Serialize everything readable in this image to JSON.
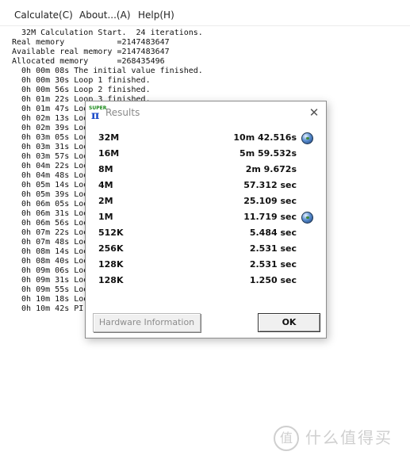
{
  "menu": {
    "calculate": "Calculate(C)",
    "about": "About...(A)",
    "help": "Help(H)"
  },
  "log_lines": [
    "  32M Calculation Start.  24 iterations.",
    "Real memory           =2147483647",
    "Available real memory =2147483647",
    "Allocated memory      =268435496",
    "  0h 00m 08s The initial value finished.",
    "  0h 00m 30s Loop 1 finished.",
    "  0h 00m 56s Loop 2 finished.",
    "  0h 01m 22s Loop 3 finished.",
    "  0h 01m 47s Loo",
    "  0h 02m 13s Loo",
    "  0h 02m 39s Loo",
    "  0h 03m 05s Loo",
    "  0h 03m 31s Loo",
    "  0h 03m 57s Loo",
    "  0h 04m 22s Loo",
    "  0h 04m 48s Loo",
    "  0h 05m 14s Loo",
    "  0h 05m 39s Loo",
    "  0h 06m 05s Loo",
    "  0h 06m 31s Loo",
    "  0h 06m 56s Loo",
    "  0h 07m 22s Loo",
    "  0h 07m 48s Loo",
    "  0h 08m 14s Loo",
    "  0h 08m 40s Loo",
    "  0h 09m 06s Loo",
    "  0h 09m 31s Loo",
    "  0h 09m 55s Loo",
    "  0h 10m 18s Loo",
    "  0h 10m 42s PI"
  ],
  "dialog": {
    "app_icon_text": "SUPER",
    "app_icon_glyph": "π",
    "title": "Results",
    "close_glyph": "✕",
    "results": [
      {
        "size": "32M",
        "time": "10m 42.516s",
        "globe": true
      },
      {
        "size": "16M",
        "time": "5m 59.532s",
        "globe": false
      },
      {
        "size": "8M",
        "time": "2m 9.672s",
        "globe": false
      },
      {
        "size": "4M",
        "time": "57.312 sec",
        "globe": false
      },
      {
        "size": "2M",
        "time": "25.109 sec",
        "globe": false
      },
      {
        "size": "1M",
        "time": "11.719 sec",
        "globe": true
      },
      {
        "size": "512K",
        "time": "5.484 sec",
        "globe": false
      },
      {
        "size": "256K",
        "time": "2.531 sec",
        "globe": false
      },
      {
        "size": "128K",
        "time": "2.531 sec",
        "globe": false
      },
      {
        "size": "128K",
        "time": "1.250 sec",
        "globe": false
      }
    ],
    "hardware_button": "Hardware Information",
    "ok_button": "OK"
  },
  "watermark": {
    "glyph": "值",
    "text": "什么值得买"
  },
  "colors": {
    "disabled_text": "#8c8c8c",
    "title_text": "#8a8a8a"
  }
}
